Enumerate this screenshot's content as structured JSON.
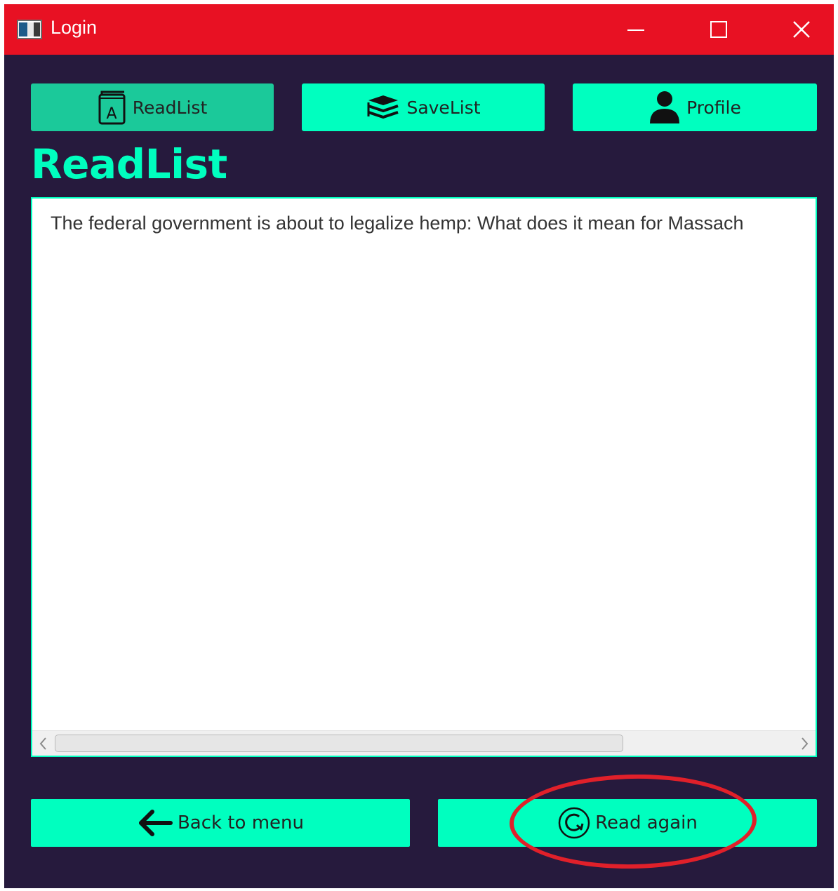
{
  "window": {
    "title": "Login",
    "controls": {
      "minimize": "minimize-icon",
      "maximize": "maximize-icon",
      "close": "close-icon"
    }
  },
  "tabs": [
    {
      "label": "ReadList",
      "icon": "book-icon",
      "active": true
    },
    {
      "label": "SaveList",
      "icon": "books-stack-icon",
      "active": false
    },
    {
      "label": "Profile",
      "icon": "user-icon",
      "active": false
    }
  ],
  "page": {
    "heading": "ReadList"
  },
  "list": {
    "items": [
      "The federal government is about to legalize hemp: What does it mean for Massach"
    ]
  },
  "buttons": {
    "back": {
      "label": "Back to menu",
      "icon": "arrow-left-icon"
    },
    "read_again": {
      "label": "Read again",
      "icon": "refresh-icon"
    }
  },
  "colors": {
    "titlebar": "#e81123",
    "background": "#261a3d",
    "accent": "#00ffbf",
    "active_tab": "#1bc99a",
    "annotation": "#e0202a"
  }
}
